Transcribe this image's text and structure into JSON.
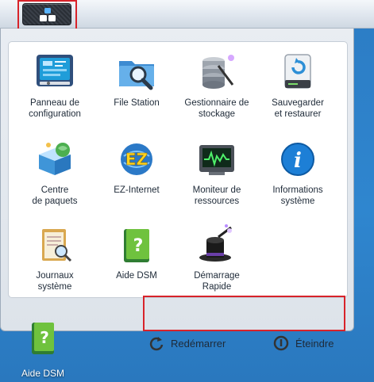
{
  "taskbar": {
    "main_menu_icon": "grid-icon"
  },
  "menu": {
    "apps": [
      {
        "label": "Panneau de\nconfiguration",
        "icon": "control-panel-icon"
      },
      {
        "label": "File Station",
        "icon": "file-station-icon"
      },
      {
        "label": "Gestionnaire de\nstockage",
        "icon": "storage-manager-icon"
      },
      {
        "label": "Sauvegarder\net restaurer",
        "icon": "backup-restore-icon"
      },
      {
        "label": "Centre\nde paquets",
        "icon": "package-center-icon"
      },
      {
        "label": "EZ-Internet",
        "icon": "ez-internet-icon"
      },
      {
        "label": "Moniteur de\nressources",
        "icon": "resource-monitor-icon"
      },
      {
        "label": "Informations\nsystème",
        "icon": "system-info-icon"
      },
      {
        "label": "Journaux\nsystème",
        "icon": "system-log-icon"
      },
      {
        "label": "Aide DSM",
        "icon": "dsm-help-icon"
      },
      {
        "label": "Démarrage\nRapide",
        "icon": "quick-start-icon"
      }
    ],
    "restart_label": "Redémarrer",
    "shutdown_label": "Éteindre"
  },
  "desktop": {
    "shortcut_label": "Aide DSM"
  },
  "colors": {
    "desktop": "#2f86cf",
    "highlight": "#d8232a",
    "panel": "#e4e9ef"
  }
}
